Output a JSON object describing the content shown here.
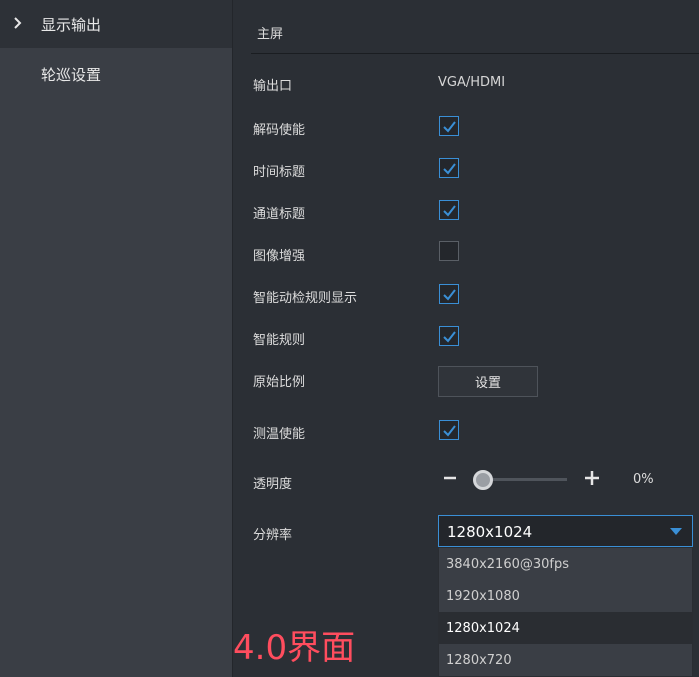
{
  "sidebar": {
    "items": [
      {
        "label": "显示输出"
      },
      {
        "label": "轮巡设置"
      }
    ]
  },
  "main": {
    "title": "主屏",
    "output_label": "输出口",
    "output_value": "VGA/HDMI",
    "rows": [
      {
        "label": "解码使能",
        "checked": true
      },
      {
        "label": "时间标题",
        "checked": true
      },
      {
        "label": "通道标题",
        "checked": true
      },
      {
        "label": "图像增强",
        "checked": false
      },
      {
        "label": "智能动检规则显示",
        "checked": true
      },
      {
        "label": "智能规则",
        "checked": true
      }
    ],
    "aspect_label": "原始比例",
    "aspect_button": "设置",
    "temp_label": "测温使能",
    "temp_checked": true,
    "transparency_label": "透明度",
    "transparency_value": "0%",
    "transparency_fraction": 0.0,
    "resolution_label": "分辨率",
    "resolution_selected": "1280x1024",
    "resolution_options": [
      "3840x2160@30fps",
      "1920x1080",
      "1280x1024",
      "1280x720"
    ]
  },
  "overlay_text": "4.0界面",
  "colors": {
    "accent": "#3a8fd6",
    "sidebar_bg": "#3a3e45",
    "main_bg": "#2b2f35",
    "watermark": "#ff4d5e"
  }
}
